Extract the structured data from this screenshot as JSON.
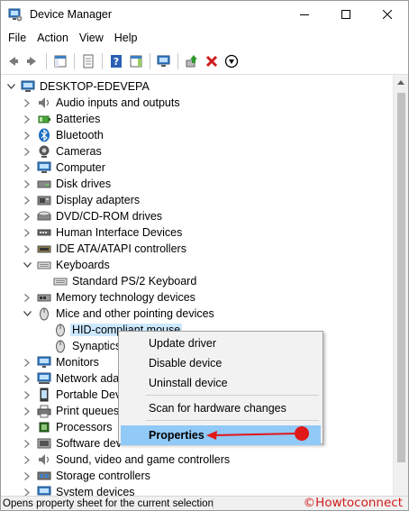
{
  "window": {
    "title": "Device Manager"
  },
  "menu": [
    "File",
    "Action",
    "View",
    "Help"
  ],
  "toolbar": [
    {
      "name": "back-icon"
    },
    {
      "name": "forward-icon"
    },
    {
      "sep": true
    },
    {
      "name": "show-hide-tree-icon"
    },
    {
      "sep": true
    },
    {
      "name": "properties-icon"
    },
    {
      "sep": true
    },
    {
      "name": "help-icon"
    },
    {
      "name": "show-hide-action-pane-icon"
    },
    {
      "sep": true
    },
    {
      "name": "scan-hardware-icon"
    },
    {
      "sep": true
    },
    {
      "name": "update-driver-icon"
    },
    {
      "name": "uninstall-icon"
    },
    {
      "name": "disable-device-icon"
    }
  ],
  "tree": [
    {
      "label": "DESKTOP-EDEVEPA",
      "level": 0,
      "expand": "open",
      "icon": "computer-root-icon"
    },
    {
      "label": "Audio inputs and outputs",
      "level": 1,
      "expand": "closed",
      "icon": "audio-icon"
    },
    {
      "label": "Batteries",
      "level": 1,
      "expand": "closed",
      "icon": "battery-icon"
    },
    {
      "label": "Bluetooth",
      "level": 1,
      "expand": "closed",
      "icon": "bluetooth-icon"
    },
    {
      "label": "Cameras",
      "level": 1,
      "expand": "closed",
      "icon": "camera-icon"
    },
    {
      "label": "Computer",
      "level": 1,
      "expand": "closed",
      "icon": "computer-icon"
    },
    {
      "label": "Disk drives",
      "level": 1,
      "expand": "closed",
      "icon": "disk-drive-icon"
    },
    {
      "label": "Display adapters",
      "level": 1,
      "expand": "closed",
      "icon": "display-adapter-icon"
    },
    {
      "label": "DVD/CD-ROM drives",
      "level": 1,
      "expand": "closed",
      "icon": "dvd-icon"
    },
    {
      "label": "Human Interface Devices",
      "level": 1,
      "expand": "closed",
      "icon": "hid-icon"
    },
    {
      "label": "IDE ATA/ATAPI controllers",
      "level": 1,
      "expand": "closed",
      "icon": "ide-controller-icon"
    },
    {
      "label": "Keyboards",
      "level": 1,
      "expand": "open",
      "icon": "keyboard-icon"
    },
    {
      "label": "Standard PS/2 Keyboard",
      "level": 2,
      "expand": "none",
      "icon": "keyboard-icon"
    },
    {
      "label": "Memory technology devices",
      "level": 1,
      "expand": "closed",
      "icon": "memory-icon"
    },
    {
      "label": "Mice and other pointing devices",
      "level": 1,
      "expand": "open",
      "icon": "mouse-icon"
    },
    {
      "label": "HID-compliant mouse",
      "level": 2,
      "expand": "none",
      "icon": "mouse-icon",
      "selected": true
    },
    {
      "label": "Synaptics",
      "level": 2,
      "expand": "none",
      "icon": "mouse-icon"
    },
    {
      "label": "Monitors",
      "level": 1,
      "expand": "closed",
      "icon": "monitor-icon"
    },
    {
      "label": "Network ada",
      "level": 1,
      "expand": "closed",
      "icon": "network-adapter-icon"
    },
    {
      "label": "Portable Dev",
      "level": 1,
      "expand": "closed",
      "icon": "portable-device-icon"
    },
    {
      "label": "Print queues",
      "level": 1,
      "expand": "closed",
      "icon": "printer-icon"
    },
    {
      "label": "Processors",
      "level": 1,
      "expand": "closed",
      "icon": "processor-icon"
    },
    {
      "label": "Software dev",
      "level": 1,
      "expand": "closed",
      "icon": "software-device-icon"
    },
    {
      "label": "Sound, video and game controllers",
      "level": 1,
      "expand": "closed",
      "icon": "sound-icon"
    },
    {
      "label": "Storage controllers",
      "level": 1,
      "expand": "closed",
      "icon": "storage-controller-icon"
    },
    {
      "label": "System devices",
      "level": 1,
      "expand": "closed",
      "icon": "system-device-icon"
    }
  ],
  "context_menu": {
    "items": [
      "Update driver",
      "Disable device",
      "Uninstall device",
      "Scan for hardware changes",
      "Properties"
    ],
    "highlighted": "Properties"
  },
  "status": {
    "text": "Opens property sheet for the current selection."
  },
  "watermark": "©Howtoconnect",
  "colors": {
    "selection": "#cce8ff",
    "menu_highlight": "#91c9f7",
    "arrow": "#e01818"
  }
}
